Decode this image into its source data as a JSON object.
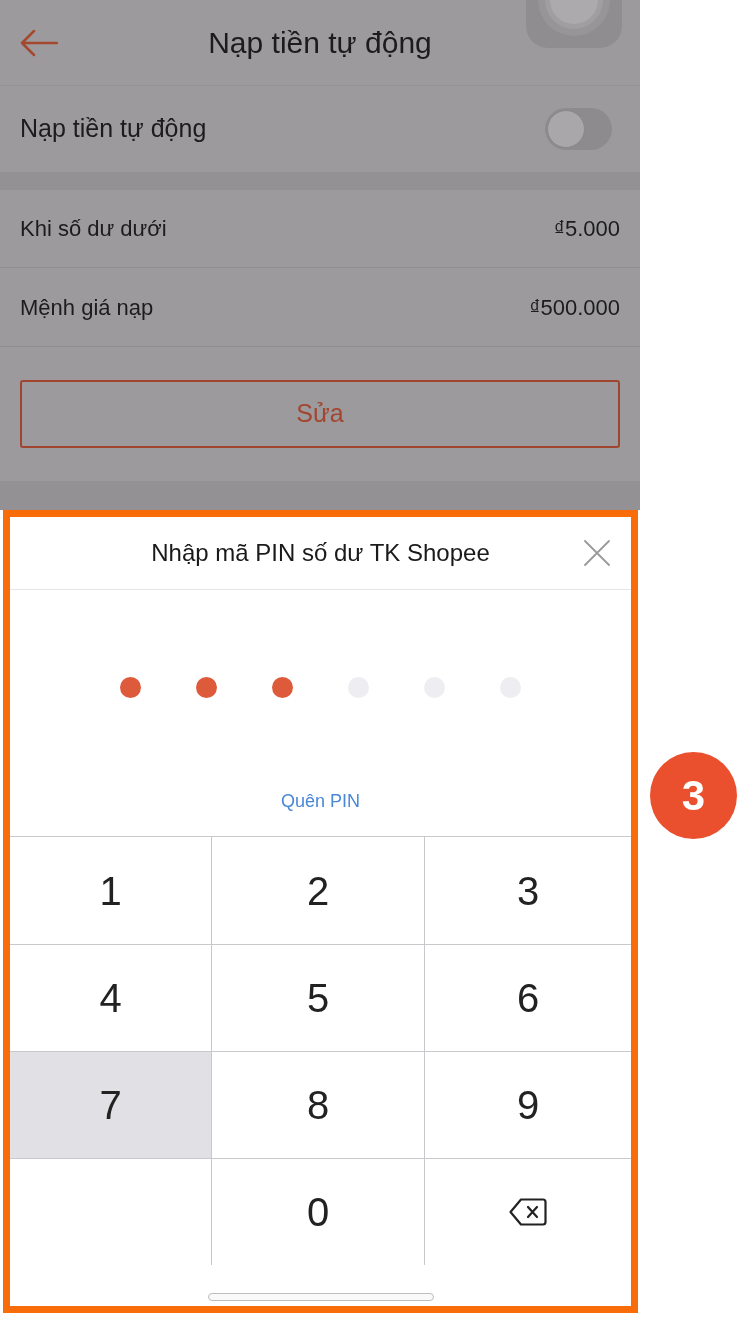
{
  "header": {
    "title": "Nạp tiền tự động"
  },
  "auto_topup": {
    "label": "Nạp tiền tự động",
    "on": false
  },
  "settings": [
    {
      "label": "Khi số dư dưới",
      "value": "₫5.000"
    },
    {
      "label": "Mệnh giá nạp",
      "value": "₫500.000"
    }
  ],
  "edit_button": {
    "label": "Sửa"
  },
  "pin_dialog": {
    "title": "Nhập mã PIN số dư TK Shopee",
    "pin_dots": [
      {
        "filled": true
      },
      {
        "filled": true
      },
      {
        "filled": true
      },
      {
        "filled": false
      },
      {
        "filled": false
      },
      {
        "filled": false
      }
    ],
    "forgot_pin_link": "Quên PIN",
    "keys": [
      {
        "kind": "digit",
        "label": "1",
        "pressed": false
      },
      {
        "kind": "digit",
        "label": "2",
        "pressed": false
      },
      {
        "kind": "digit",
        "label": "3",
        "pressed": false
      },
      {
        "kind": "digit",
        "label": "4",
        "pressed": false
      },
      {
        "kind": "digit",
        "label": "5",
        "pressed": false
      },
      {
        "kind": "digit",
        "label": "6",
        "pressed": false
      },
      {
        "kind": "digit",
        "label": "7",
        "pressed": true
      },
      {
        "kind": "digit",
        "label": "8",
        "pressed": false
      },
      {
        "kind": "digit",
        "label": "9",
        "pressed": false
      },
      {
        "kind": "blank"
      },
      {
        "kind": "digit",
        "label": "0",
        "pressed": false
      },
      {
        "kind": "backspace",
        "pressed": false
      }
    ]
  },
  "step_badge": {
    "label": "3"
  }
}
